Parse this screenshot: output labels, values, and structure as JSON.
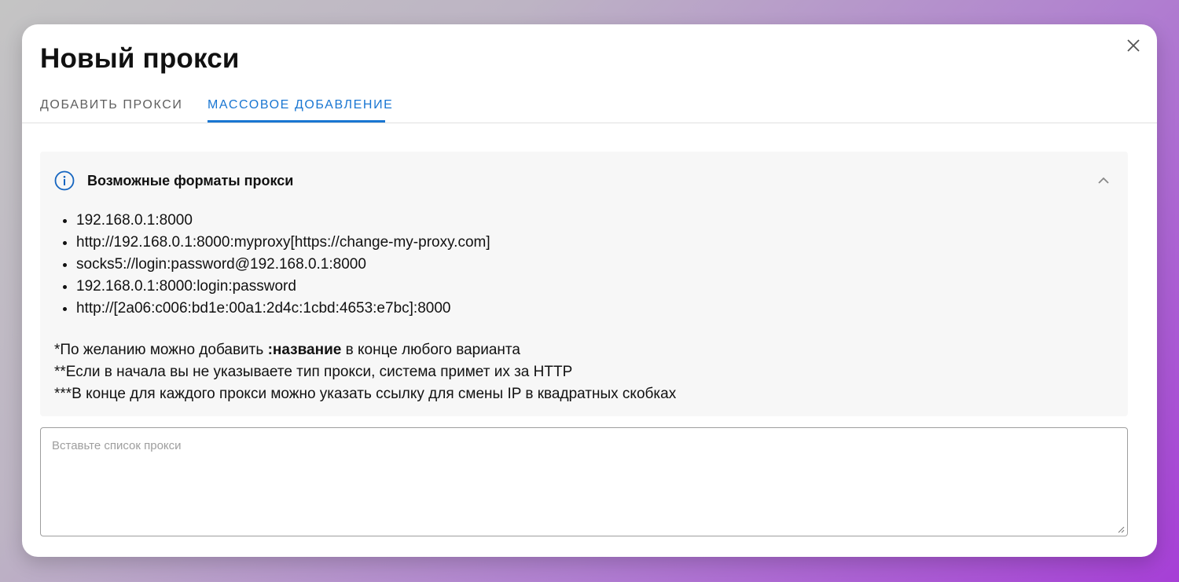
{
  "dialog": {
    "title": "Новый прокси",
    "close_icon": "close-icon"
  },
  "tabs": [
    {
      "label": "ДОБАВИТЬ ПРОКСИ",
      "active": false
    },
    {
      "label": "МАССОВОЕ ДОБАВЛЕНИЕ",
      "active": true
    }
  ],
  "info": {
    "icon": "info-icon",
    "title": "Возможные форматы прокси",
    "collapse_icon": "chevron-up-icon",
    "formats": [
      "192.168.0.1:8000",
      "http://192.168.0.1:8000:myproxy[https://change-my-proxy.com]",
      "socks5://login:password@192.168.0.1:8000",
      "192.168.0.1:8000:login:password",
      "http://[2a06:c006:bd1e:00a1:2d4c:1cbd:4653:e7bc]:8000"
    ],
    "note1_prefix": "*По желанию можно добавить ",
    "note1_bold": ":название",
    "note1_suffix": " в конце любого варианта",
    "note2": "**Если в начала вы не указываете тип прокси, система примет их за HTTP",
    "note3": "***В конце для каждого прокси можно указать ссылку для смены IP в квадратных скобках"
  },
  "input": {
    "value": "",
    "placeholder": "Вставьте список прокси"
  },
  "colors": {
    "accent": "#1976d2",
    "info_bg": "#f7f7f7",
    "info_icon": "#1565c0"
  }
}
